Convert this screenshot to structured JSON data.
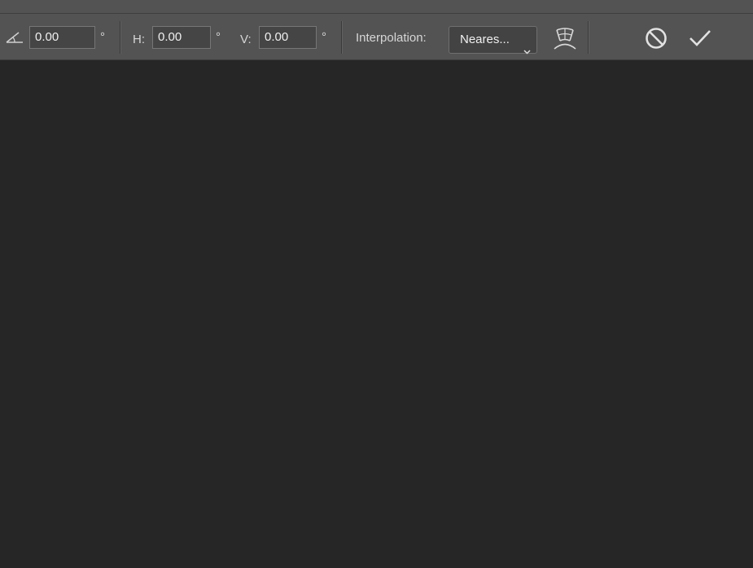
{
  "options_bar": {
    "angle": {
      "icon": "angle-icon",
      "value": "0.00",
      "unit": "°"
    },
    "horizontal_skew": {
      "label": "H:",
      "value": "0.00",
      "unit": "°"
    },
    "vertical_skew": {
      "label": "V:",
      "value": "0.00",
      "unit": "°"
    },
    "interpolation": {
      "label": "Interpolation:",
      "selected": "Neares...",
      "icon": "chevron-down-icon"
    },
    "warp_toggle_icon": "warp-icon",
    "cancel_icon": "cancel-icon",
    "commit_icon": "checkmark-icon"
  },
  "colors": {
    "toolbar_bg": "#535353",
    "canvas_bg": "#262626",
    "field_bg": "#454545"
  }
}
